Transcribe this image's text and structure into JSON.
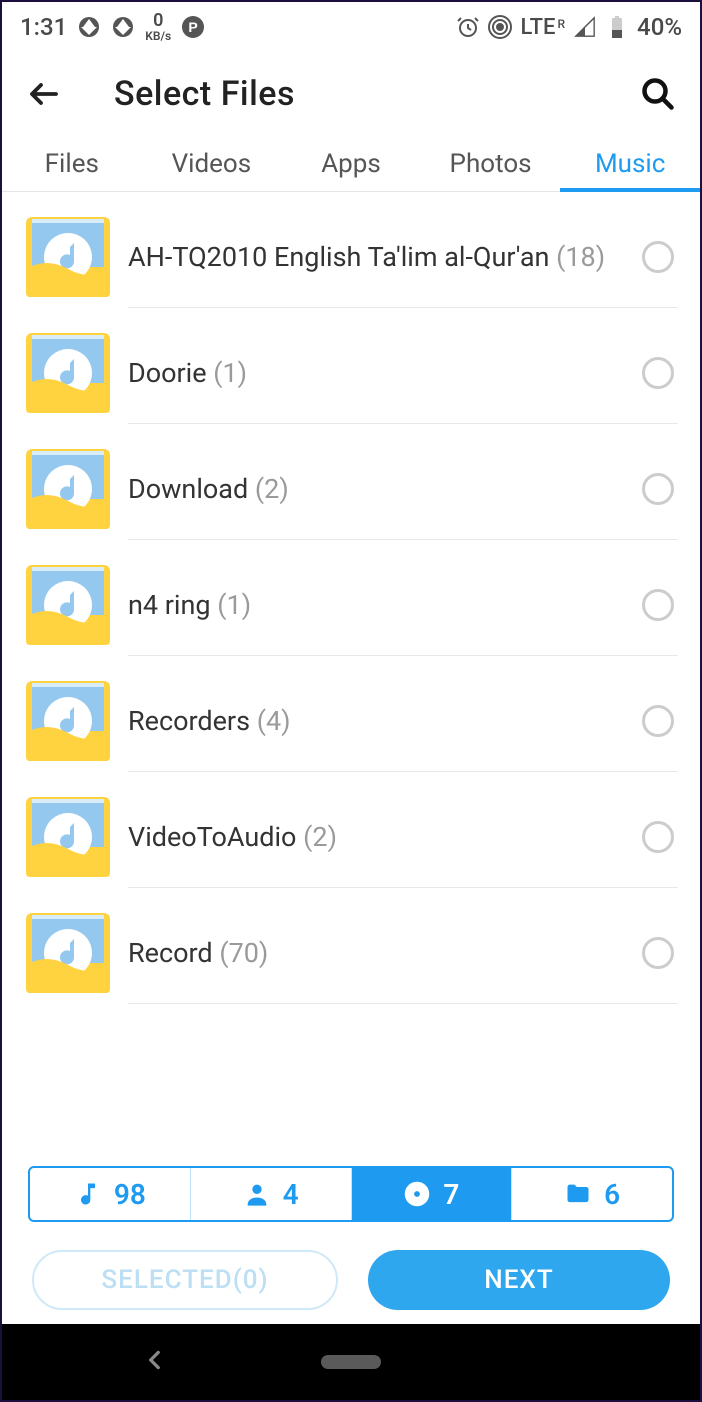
{
  "status": {
    "time": "1:31",
    "kbs_value": "0",
    "kbs_label": "KB/s",
    "network": "LTE",
    "network_sup": "R",
    "battery": "40%"
  },
  "header": {
    "title": "Select Files"
  },
  "tabs": [
    {
      "label": "Files",
      "active": false
    },
    {
      "label": "Videos",
      "active": false
    },
    {
      "label": "Apps",
      "active": false
    },
    {
      "label": "Photos",
      "active": false
    },
    {
      "label": "Music",
      "active": true
    }
  ],
  "items": [
    {
      "name": "AH-TQ2010 English Ta'lim al-Qur'an",
      "count": "(18)"
    },
    {
      "name": "Doorie",
      "count": "(1)"
    },
    {
      "name": "Download",
      "count": "(2)"
    },
    {
      "name": "n4 ring",
      "count": "(1)"
    },
    {
      "name": "Recorders",
      "count": "(4)"
    },
    {
      "name": "VideoToAudio",
      "count": "(2)"
    },
    {
      "name": "Record",
      "count": "(70)"
    }
  ],
  "counts": {
    "music": "98",
    "people": "4",
    "disc": "7",
    "folder": "6"
  },
  "actions": {
    "selected": "SELECTED(0)",
    "next": "NEXT"
  }
}
